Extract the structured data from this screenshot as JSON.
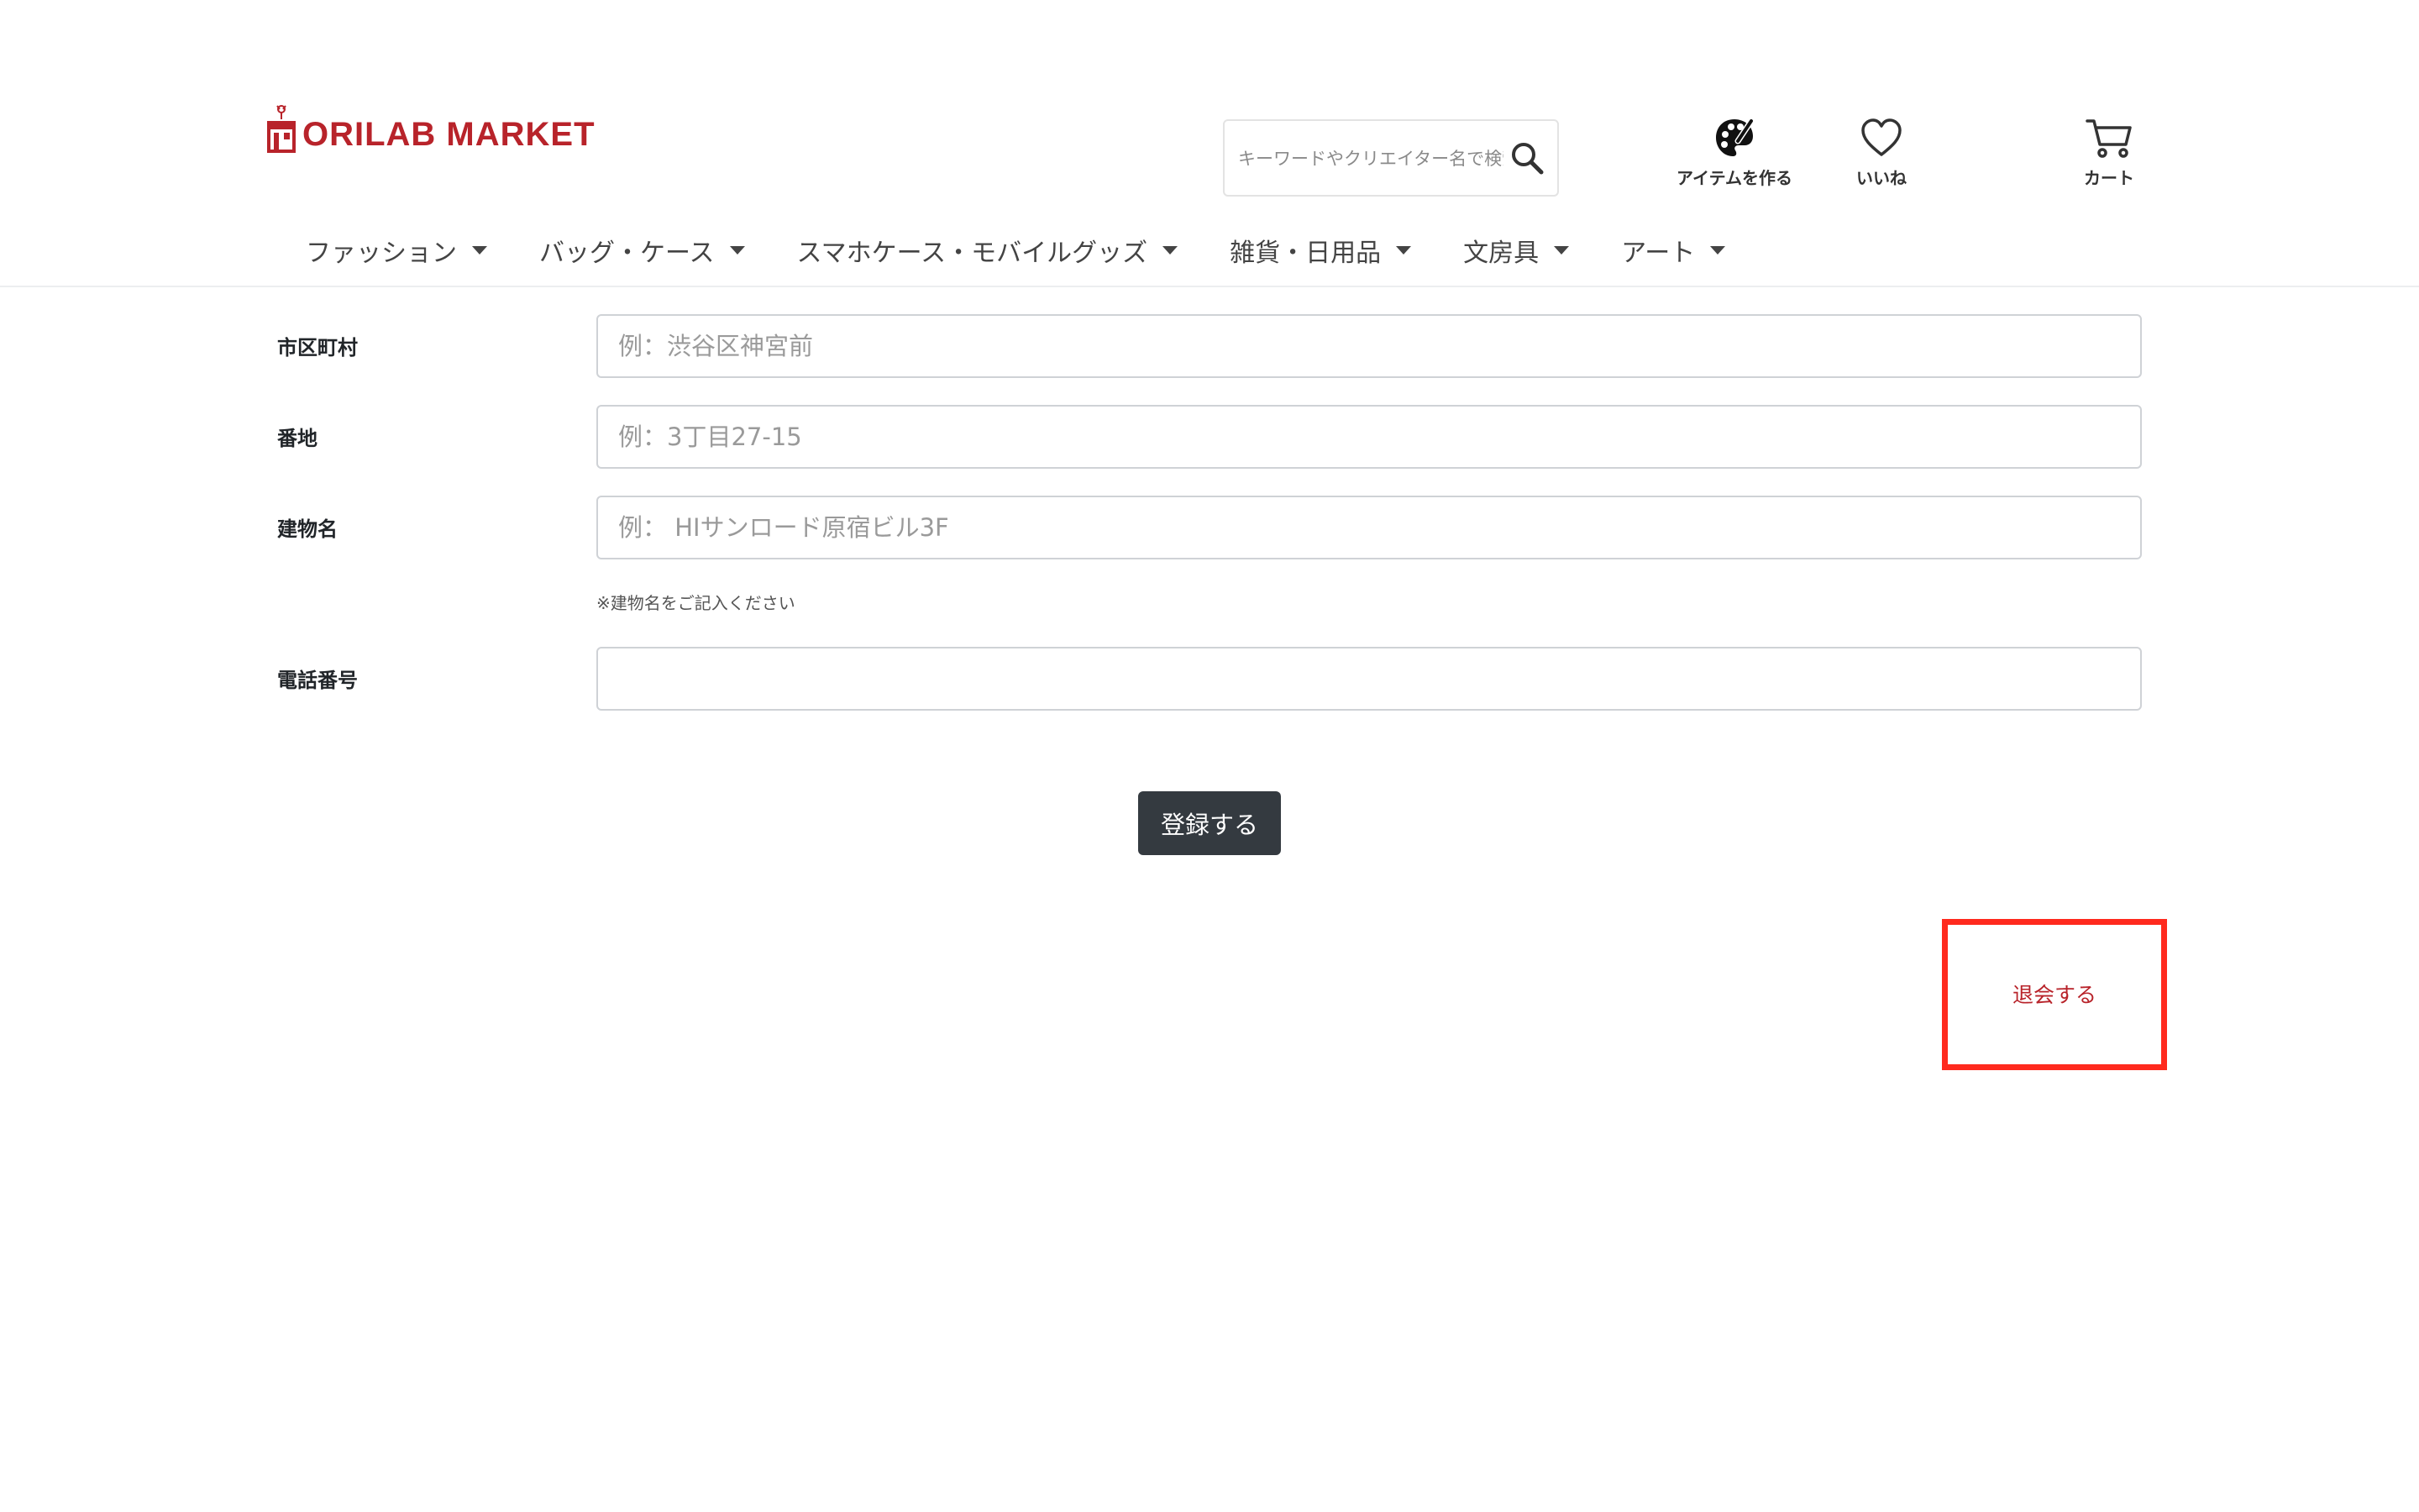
{
  "header": {
    "logo_text": "ORILAB MARKET",
    "search": {
      "placeholder": "キーワードやクリエイター名で検索"
    },
    "actions": [
      {
        "label": "アイテムを作る",
        "icon": "palette-icon"
      },
      {
        "label": "いいね",
        "icon": "heart-icon"
      },
      {
        "label": "カート",
        "icon": "cart-icon"
      }
    ],
    "nav": [
      {
        "label": "ファッション"
      },
      {
        "label": "バッグ・ケース"
      },
      {
        "label": "スマホケース・モバイルグッズ"
      },
      {
        "label": "雑貨・日用品"
      },
      {
        "label": "文房具"
      },
      {
        "label": "アート"
      }
    ]
  },
  "form": {
    "fields": [
      {
        "label": "市区町村",
        "placeholder": "例：渋谷区神宮前",
        "value": ""
      },
      {
        "label": "番地",
        "placeholder": "例：3丁目27-15",
        "value": ""
      },
      {
        "label": "建物名",
        "placeholder": "例： HIサンロード原宿ビル3F",
        "value": "",
        "hint": "※建物名をご記入ください"
      },
      {
        "label": "電話番号",
        "placeholder": "",
        "value": ""
      }
    ],
    "submit_label": "登録する"
  },
  "withdraw": {
    "label": "退会する"
  },
  "colors": {
    "brand": "#b8232a",
    "button": "#343a40",
    "highlight": "#ff2a1e"
  }
}
